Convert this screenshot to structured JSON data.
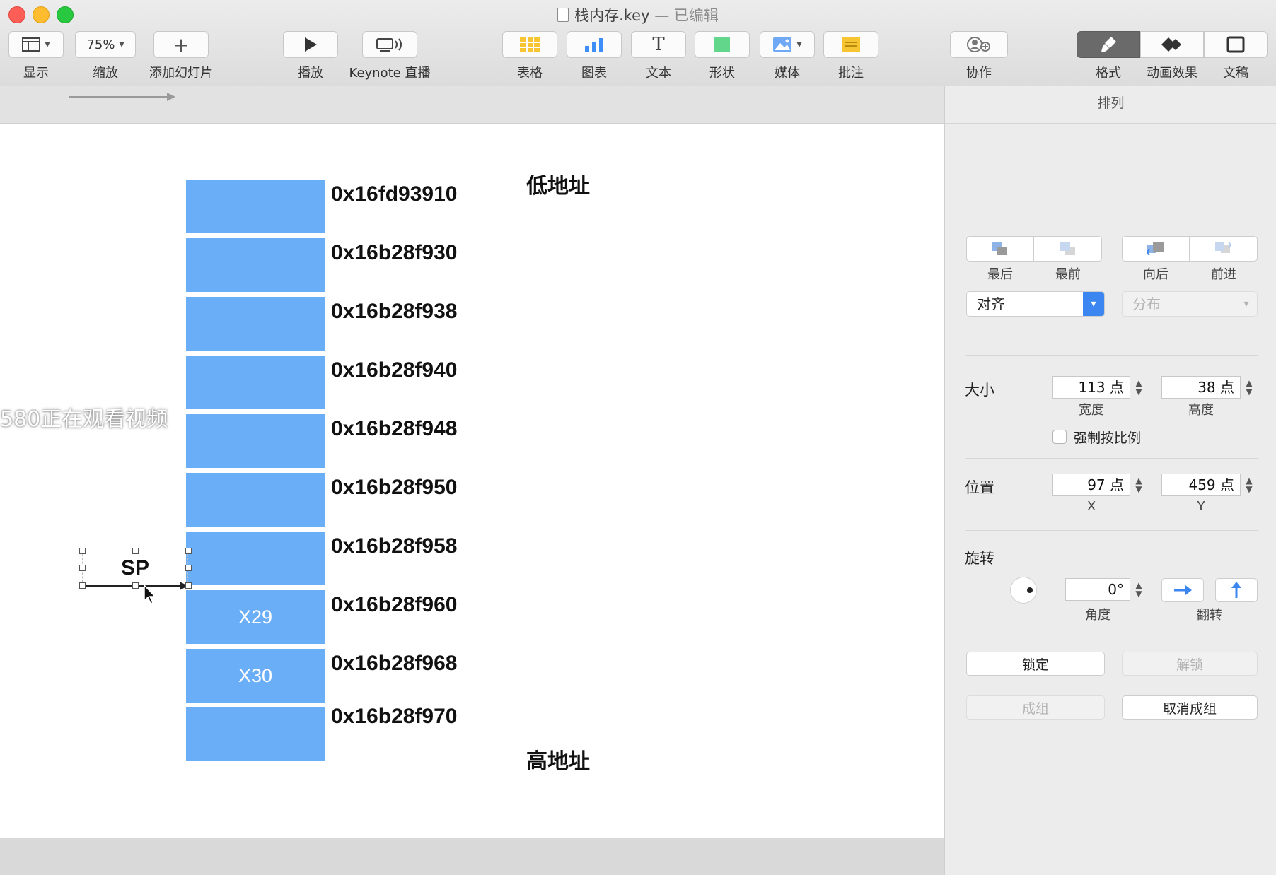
{
  "window": {
    "title": "栈内存.key",
    "title_separator": "—",
    "edited_status": "已编辑"
  },
  "toolbar": {
    "view_label": "显示",
    "zoom_value": "75%",
    "zoom_label": "缩放",
    "add_slide_label": "添加幻灯片",
    "play_label": "播放",
    "keynote_live_label": "Keynote 直播",
    "table_label": "表格",
    "chart_label": "图表",
    "text_label": "文本",
    "shape_label": "形状",
    "media_label": "媒体",
    "comment_label": "批注",
    "collaborate_label": "协作",
    "format_label": "格式",
    "animate_label": "动画效果",
    "document_label": "文稿"
  },
  "slide": {
    "low_address_label": "低地址",
    "high_address_label": "高地址",
    "cells": [
      {
        "text": "",
        "address": "0x16fd93910"
      },
      {
        "text": "",
        "address": "0x16b28f930"
      },
      {
        "text": "",
        "address": "0x16b28f938"
      },
      {
        "text": "",
        "address": "0x16b28f940"
      },
      {
        "text": "",
        "address": "0x16b28f948"
      },
      {
        "text": "",
        "address": "0x16b28f950"
      },
      {
        "text": "",
        "address": "0x16b28f958"
      },
      {
        "text": "X29",
        "address": "0x16b28f960"
      },
      {
        "text": "X30",
        "address": "0x16b28f968"
      },
      {
        "text": "",
        "address": "0x16b28f970"
      }
    ],
    "sp_label": "SP",
    "watermark": "580正在观看视频"
  },
  "inspector": {
    "tab": "排列",
    "order": {
      "back_label": "最后",
      "front_label": "最前",
      "backward_label": "向后",
      "forward_label": "前进"
    },
    "align_label": "对齐",
    "distribute_label": "分布",
    "size": {
      "section_label": "大小",
      "width_value": "113 点",
      "width_label": "宽度",
      "height_value": "38 点",
      "height_label": "高度",
      "constrain_label": "强制按比例"
    },
    "position": {
      "section_label": "位置",
      "x_value": "97 点",
      "x_label": "X",
      "y_value": "459 点",
      "y_label": "Y"
    },
    "rotate": {
      "section_label": "旋转",
      "angle_value": "0°",
      "angle_label": "角度",
      "flip_label": "翻转"
    },
    "lock_label": "锁定",
    "unlock_label": "解锁",
    "group_label": "成组",
    "ungroup_label": "取消成组"
  },
  "colors": {
    "cell_fill": "#6aaef8",
    "accent": "#3b86f0"
  }
}
